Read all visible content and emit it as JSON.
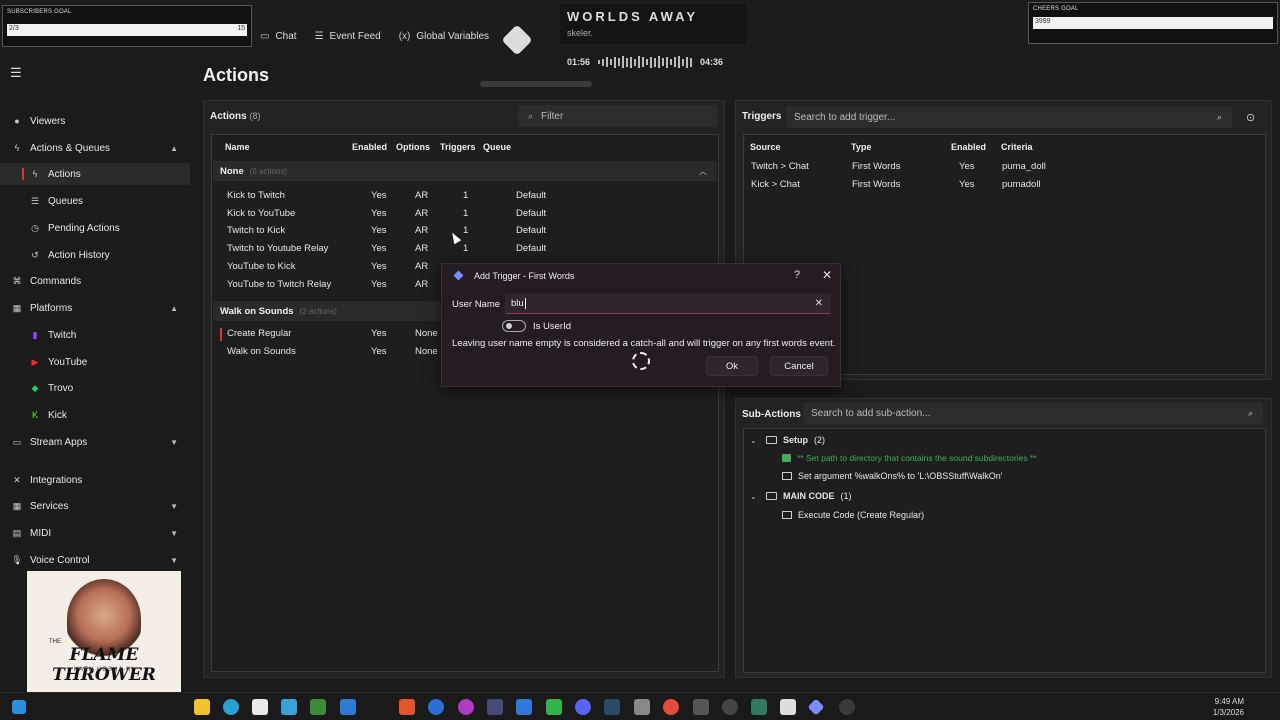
{
  "overlay": {
    "subs_goal_label": "SUBSCRIBERS GOAL",
    "subs_goal_current": "2/3",
    "subs_goal_target": "15",
    "cheers_goal_label": "CHEERS GOAL",
    "cheers_goal_current": "3999",
    "now_playing_title": "WORLDS AWAY",
    "now_playing_artist": "skeler.",
    "time_elapsed": "01:56",
    "time_total": "04:36"
  },
  "tabs": [
    {
      "label": "Chat",
      "icon": "chat-icon"
    },
    {
      "label": "Event Feed",
      "icon": "event-feed-icon"
    },
    {
      "label": "Global Variables",
      "icon": "variable-icon"
    }
  ],
  "sidebar": {
    "items": [
      {
        "label": "Viewers",
        "icon": "viewers-icon",
        "sub": false,
        "chevron": ""
      },
      {
        "label": "Actions & Queues",
        "icon": "actions-icon",
        "sub": false,
        "chevron": "up"
      },
      {
        "label": "Actions",
        "icon": "actions-icon",
        "sub": true,
        "chevron": "",
        "active": true
      },
      {
        "label": "Queues",
        "icon": "queues-icon",
        "sub": true,
        "chevron": ""
      },
      {
        "label": "Pending Actions",
        "icon": "pending-icon",
        "sub": true,
        "chevron": ""
      },
      {
        "label": "Action History",
        "icon": "history-icon",
        "sub": true,
        "chevron": ""
      },
      {
        "label": "Commands",
        "icon": "commands-icon",
        "sub": false,
        "chevron": ""
      },
      {
        "label": "Platforms",
        "icon": "platforms-icon",
        "sub": false,
        "chevron": "up"
      },
      {
        "label": "Twitch",
        "icon": "twitch-icon",
        "sub": true,
        "chevron": ""
      },
      {
        "label": "YouTube",
        "icon": "youtube-icon",
        "sub": true,
        "chevron": ""
      },
      {
        "label": "Trovo",
        "icon": "trovo-icon",
        "sub": true,
        "chevron": ""
      },
      {
        "label": "Kick",
        "icon": "kick-icon",
        "sub": true,
        "chevron": ""
      },
      {
        "label": "Stream Apps",
        "icon": "stream-apps-icon",
        "sub": false,
        "chevron": "down"
      },
      {
        "label": "Integrations",
        "icon": "integrations-icon",
        "sub": false,
        "chevron": ""
      },
      {
        "label": "Services",
        "icon": "services-icon",
        "sub": false,
        "chevron": "down"
      },
      {
        "label": "MIDI",
        "icon": "midi-icon",
        "sub": false,
        "chevron": "down"
      },
      {
        "label": "Voice Control",
        "icon": "voice-icon",
        "sub": false,
        "chevron": "down"
      }
    ]
  },
  "webcam": {
    "title": "FLAME THROWER",
    "small": "THE",
    "signature": "KAEN HOSHA-KI"
  },
  "page_title": "Actions",
  "actions_panel": {
    "heading": "Actions",
    "count": "(8)",
    "filter_placeholder": "Filter",
    "columns": [
      "Name",
      "Enabled",
      "Options",
      "Triggers",
      "Queue"
    ],
    "groups": [
      {
        "name": "None",
        "sub": "(6 actions)",
        "rows": [
          {
            "name": "Kick to Twitch",
            "enabled": "Yes",
            "options": "AR",
            "triggers": "1",
            "queue": "Default"
          },
          {
            "name": "Kick to YouTube",
            "enabled": "Yes",
            "options": "AR",
            "triggers": "1",
            "queue": "Default"
          },
          {
            "name": "Twitch to Kick",
            "enabled": "Yes",
            "options": "AR",
            "triggers": "1",
            "queue": "Default"
          },
          {
            "name": "Twitch to Youtube Relay",
            "enabled": "Yes",
            "options": "AR",
            "triggers": "1",
            "queue": "Default"
          },
          {
            "name": "YouTube to Kick",
            "enabled": "Yes",
            "options": "AR",
            "triggers": "",
            "queue": ""
          },
          {
            "name": "YouTube to Twitch Relay",
            "enabled": "Yes",
            "options": "AR",
            "triggers": "",
            "queue": ""
          }
        ]
      },
      {
        "name": "Walk on Sounds",
        "sub": "(2 actions)",
        "rows": [
          {
            "name": "Create Regular",
            "enabled": "Yes",
            "options": "None",
            "triggers": "",
            "queue": ""
          },
          {
            "name": "Walk on Sounds",
            "enabled": "Yes",
            "options": "None",
            "triggers": "",
            "queue": ""
          }
        ]
      }
    ]
  },
  "triggers_panel": {
    "heading": "Triggers",
    "search_placeholder": "Search to add trigger...",
    "columns": [
      "Source",
      "Type",
      "Enabled",
      "Criteria"
    ],
    "rows": [
      {
        "source": "Twitch > Chat",
        "type": "First Words",
        "enabled": "Yes",
        "criteria": "puma_doll"
      },
      {
        "source": "Kick > Chat",
        "type": "First Words",
        "enabled": "Yes",
        "criteria": "pumadoll"
      }
    ]
  },
  "subactions_panel": {
    "heading": "Sub-Actions",
    "search_placeholder": "Search to add sub-action...",
    "tree": [
      {
        "kind": "group",
        "label": "Setup",
        "count": "(2)"
      },
      {
        "kind": "comment",
        "label": "** Set path to directory that contains the sound subdirectories **"
      },
      {
        "kind": "item",
        "label": "Set argument %walkOns% to 'L:\\OBSStuff\\WalkOn'"
      },
      {
        "kind": "group",
        "label": "MAIN CODE",
        "count": "(1)"
      },
      {
        "kind": "item",
        "label": "Execute Code (Create Regular)"
      }
    ]
  },
  "modal": {
    "title": "Add Trigger - First Words",
    "help": "?",
    "close": "✕",
    "field_label": "User Name",
    "field_value": "blu",
    "toggle_label": "Is UserId",
    "note": "Leaving user name empty is considered a catch-all and will trigger on any first words event.",
    "ok_label": "Ok",
    "cancel_label": "Cancel"
  },
  "taskbar": {
    "time": "9:49 AM",
    "date": "1/3/2026"
  }
}
